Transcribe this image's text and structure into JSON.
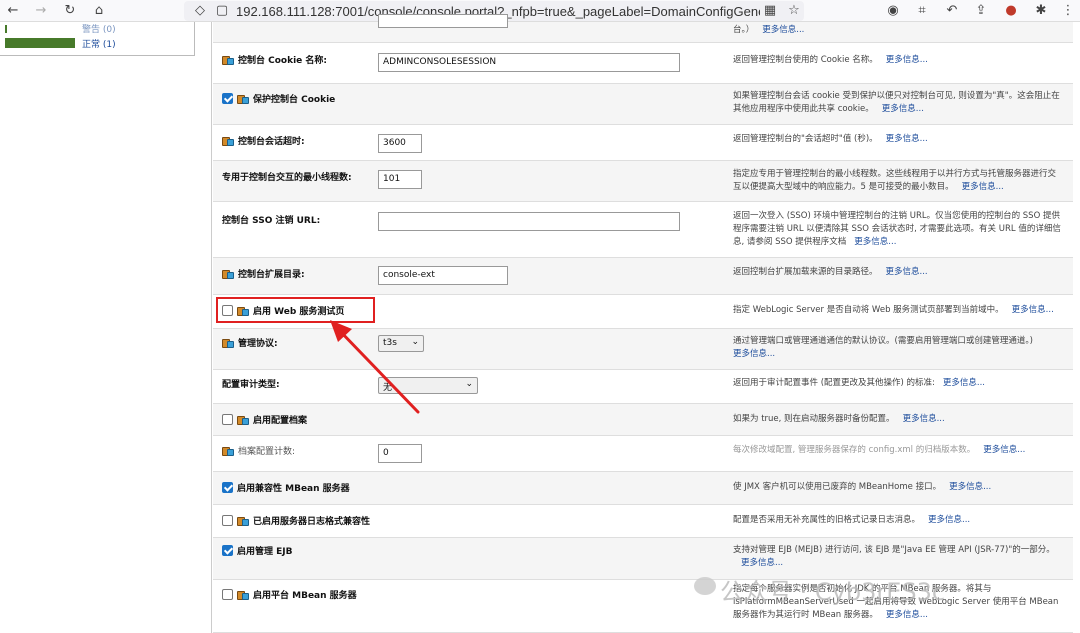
{
  "browser": {
    "url": "192.168.111.128:7001/console/console.portal?_nfpb=true&_pageLabel=DomainConfigGeneralP..."
  },
  "left": {
    "item1": "警告 (0)",
    "item2": "正常 (1)"
  },
  "rows": {
    "r0": {
      "desc": "台。）",
      "more": "更多信息..."
    },
    "cookie_name": {
      "label": "控制台 Cookie 名称:",
      "value": "ADMINCONSOLESESSION",
      "desc": "返回管理控制台使用的 Cookie 名称。",
      "more": "更多信息..."
    },
    "protect_cookie": {
      "label": "保护控制台 Cookie",
      "desc": "如果管理控制台会话 cookie 受到保护以便只对控制台可见, 则设置为\"真\"。这会阻止在其他应用程序中使用此共享 cookie。",
      "more": "更多信息..."
    },
    "session_timeout": {
      "label": "控制台会话超时:",
      "value": "3600",
      "desc": "返回管理控制台的\"会话超时\"值 (秒)。",
      "more": "更多信息..."
    },
    "min_threads": {
      "label": "专用于控制台交互的最小线程数:",
      "value": "101",
      "desc": "指定应专用于管理控制台的最小线程数。这些线程用于以并行方式与托管服务器进行交互以便提高大型域中的响应能力。5 是可接受的最小数目。",
      "more": "更多信息..."
    },
    "sso_url": {
      "label": "控制台 SSO 注销 URL:",
      "value": "",
      "desc": "返回一次登入 (SSO) 环境中管理控制台的注销 URL。仅当您使用的控制台的 SSO 提供程序需要注销 URL 以便清除其 SSO 会话状态时, 才需要此选项。有关 URL 值的详细信息, 请参阅 SSO 提供程序文档",
      "more": "更多信息..."
    },
    "ext_dir": {
      "label": "控制台扩展目录:",
      "value": "console-ext",
      "desc": "返回控制台扩展加载来源的目录路径。",
      "more": "更多信息..."
    },
    "web_test": {
      "label": "启用 Web 服务测试页",
      "desc": "指定 WebLogic Server 是否自动将 Web 服务测试页部署到当前域中。",
      "more": "更多信息..."
    },
    "admin_protocol": {
      "label": "管理协议:",
      "value": "t3s",
      "desc": "通过管理端口或管理通道通信的默认协议。(需要启用管理端口或创建管理通道。)",
      "more": "更多信息..."
    },
    "audit_type": {
      "label": "配置审计类型:",
      "value": "无",
      "desc": "返回用于审计配置事件 (配置更改及其他操作) 的标准:",
      "more": "更多信息..."
    },
    "config_archive": {
      "label": "启用配置档案",
      "desc": "如果为 true, 则在启动服务器时备份配置。",
      "more": "更多信息..."
    },
    "archive_count": {
      "label": "档案配置计数:",
      "value": "0",
      "desc": "每次修改域配置, 管理服务器保存的 config.xml 的归档版本数。",
      "more": "更多信息..."
    },
    "compat_mbean": {
      "label": "启用兼容性 MBean 服务器",
      "desc": "使 JMX 客户机可以使用已废弃的 MBeanHome 接口。",
      "more": "更多信息..."
    },
    "log_compat": {
      "label": "已启用服务器日志格式兼容性",
      "desc": "配置是否采用无补充属性的旧格式记录日志消息。",
      "more": "更多信息..."
    },
    "mejb": {
      "label": "启用管理 EJB",
      "desc": "支持对管理 EJB (MEJB) 进行访问, 该 EJB 是\"Java EE 管理 API (JSR-77)\"的一部分。",
      "more": "更多信息..."
    },
    "platform_mbean": {
      "label": "启用平台 MBean 服务器",
      "desc": "指定每个服务器实例是否初始化 JDK 的平台 MBean 服务器。将其与 isPlatformMBeanServerUsed 一起启用将导致 WebLogic Server 使用平台 MBean 服务器作为其运行时 MBean 服务器。",
      "more": "更多信息..."
    }
  },
  "watermark": "公众号 · Cyb3rES3c",
  "colors": {
    "accent": "#1a73c8",
    "highlight": "#e02020"
  }
}
